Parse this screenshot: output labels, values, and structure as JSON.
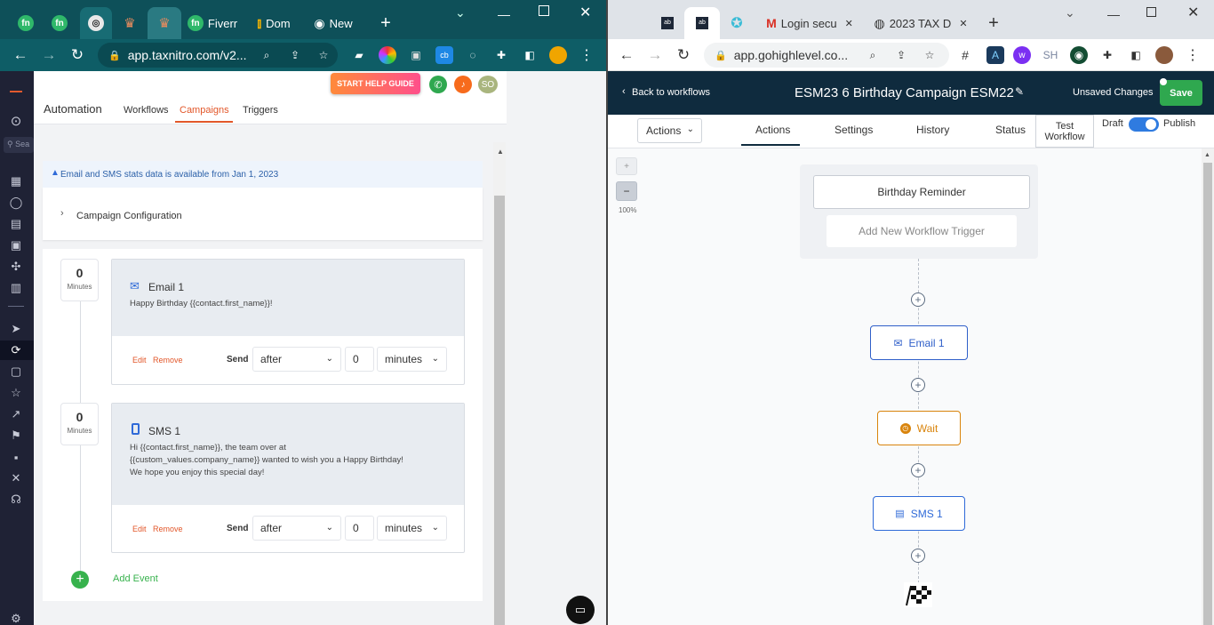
{
  "left_browser": {
    "tabs": [
      {
        "label": "",
        "icon": "fn-icon"
      },
      {
        "label": "",
        "icon": "fn-icon"
      },
      {
        "label": "",
        "icon": "openai-icon"
      },
      {
        "label": "",
        "icon": "app-icon"
      },
      {
        "label": "",
        "icon": "app-icon"
      },
      {
        "label": "Fiverr",
        "icon": "fn-icon"
      },
      {
        "label": "Dom",
        "icon": "analytics-icon"
      },
      {
        "label": "New",
        "icon": "chrome-icon"
      }
    ],
    "url": "app.taxnitro.com/v2..."
  },
  "left_app": {
    "help_button": "START HELP GUIDE",
    "avatar_initials": "SO",
    "section_title": "Automation",
    "tabs": [
      "Workflows",
      "Campaigns",
      "Triggers"
    ],
    "info_banner": "Email and SMS stats data is available from Jan 1, 2023",
    "config_label": "Campaign Configuration",
    "events": [
      {
        "delay_value": "0",
        "delay_unit": "Minutes",
        "title": "Email 1",
        "body": "Happy Birthday {{contact.first_name}}!",
        "edit": "Edit",
        "remove": "Remove",
        "send_label": "Send",
        "timing": "after",
        "amount": "0",
        "unit": "minutes"
      },
      {
        "delay_value": "0",
        "delay_unit": "Minutes",
        "title": "SMS 1",
        "body_lines": [
          "Hi {{contact.first_name}}, the team over at",
          "{{custom_values.company_name}} wanted to wish you a Happy Birthday!",
          "We hope you enjoy this special day!"
        ],
        "edit": "Edit",
        "remove": "Remove",
        "send_label": "Send",
        "timing": "after",
        "amount": "0",
        "unit": "minutes"
      }
    ],
    "add_event": "Add Event",
    "search_placeholder": "Sea"
  },
  "right_browser": {
    "tabs": [
      {
        "label": "",
        "icon": "app-icon"
      },
      {
        "label": "",
        "icon": "app-icon"
      },
      {
        "label": "",
        "icon": "swirl-icon"
      },
      {
        "label": "Login secu",
        "icon": "gmail-icon"
      },
      {
        "label": "2023 TAX D",
        "icon": "globe-icon"
      }
    ],
    "url": "app.gohighlevel.co...",
    "ext_text": "SH"
  },
  "right_app": {
    "back": "Back to workflows",
    "title": "ESM23 6 Birthday Campaign ESM22",
    "unsaved": "Unsaved Changes",
    "save": "Save",
    "actions_dropdown": "Actions",
    "tabs": [
      "Actions",
      "Settings",
      "History",
      "Status"
    ],
    "test_workflow": [
      "Test",
      "Workflow"
    ],
    "draft": "Draft",
    "publish": "Publish",
    "zoom_plus": "+",
    "zoom_minus": "−",
    "zoom": "100%",
    "trigger": "Birthday Reminder",
    "add_trigger": "Add New Workflow Trigger",
    "nodes": {
      "email": "Email 1",
      "wait": "Wait",
      "sms": "SMS 1"
    }
  },
  "colors": {
    "teal": "#0e4f58",
    "left_chrome": "#0e5d66",
    "accent": "#e2572a",
    "blue": "#2f6ad8",
    "orange": "#d9840c",
    "green": "#37b24d",
    "navy": "#0f2b3e"
  }
}
